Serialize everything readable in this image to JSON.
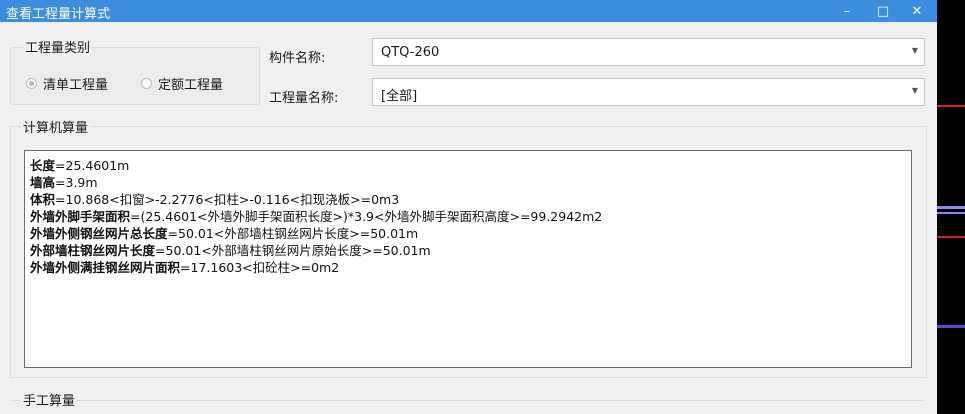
{
  "window": {
    "title": "查看工程量计算式",
    "buttons": {
      "minimize": "–",
      "maximize": "□",
      "close": "✕"
    }
  },
  "qty_type": {
    "legend": "工程量类别",
    "options": [
      {
        "label": "清单工程量",
        "selected": true
      },
      {
        "label": "定额工程量",
        "selected": false
      }
    ]
  },
  "component": {
    "label": "构件名称:",
    "value": "QTQ-260"
  },
  "qty_name": {
    "label": "工程量名称:",
    "value": "[全部]"
  },
  "computer_calc": {
    "legend": "计算机算量",
    "lines": [
      {
        "name": "长度",
        "expr": "=25.4601m"
      },
      {
        "name": "墙高",
        "expr": "=3.9m"
      },
      {
        "name": "体积",
        "expr": "=10.868<扣窗>-2.2776<扣柱>-0.116<扣现浇板>=0m3"
      },
      {
        "name": "外墙外脚手架面积",
        "expr": "=(25.4601<外墙外脚手架面积长度>)*3.9<外墙外脚手架面积高度>=99.2942m2"
      },
      {
        "name": "外墙外侧钢丝网片总长度",
        "expr": "=50.01<外部墙柱钢丝网片长度>=50.01m"
      },
      {
        "name": "外部墙柱钢丝网片长度",
        "expr": "=50.01<外部墙柱钢丝网片原始长度>=50.01m"
      },
      {
        "name": "外墙外侧满挂钢丝网片面积",
        "expr": "=17.1603<扣砼柱>=0m2"
      }
    ]
  },
  "manual_calc": {
    "legend": "手工算量"
  },
  "colors": {
    "titlebar": "#3c8dde",
    "background": "#f0f0f0",
    "side_marks": [
      "#d42020",
      "#5a4ad0"
    ]
  }
}
